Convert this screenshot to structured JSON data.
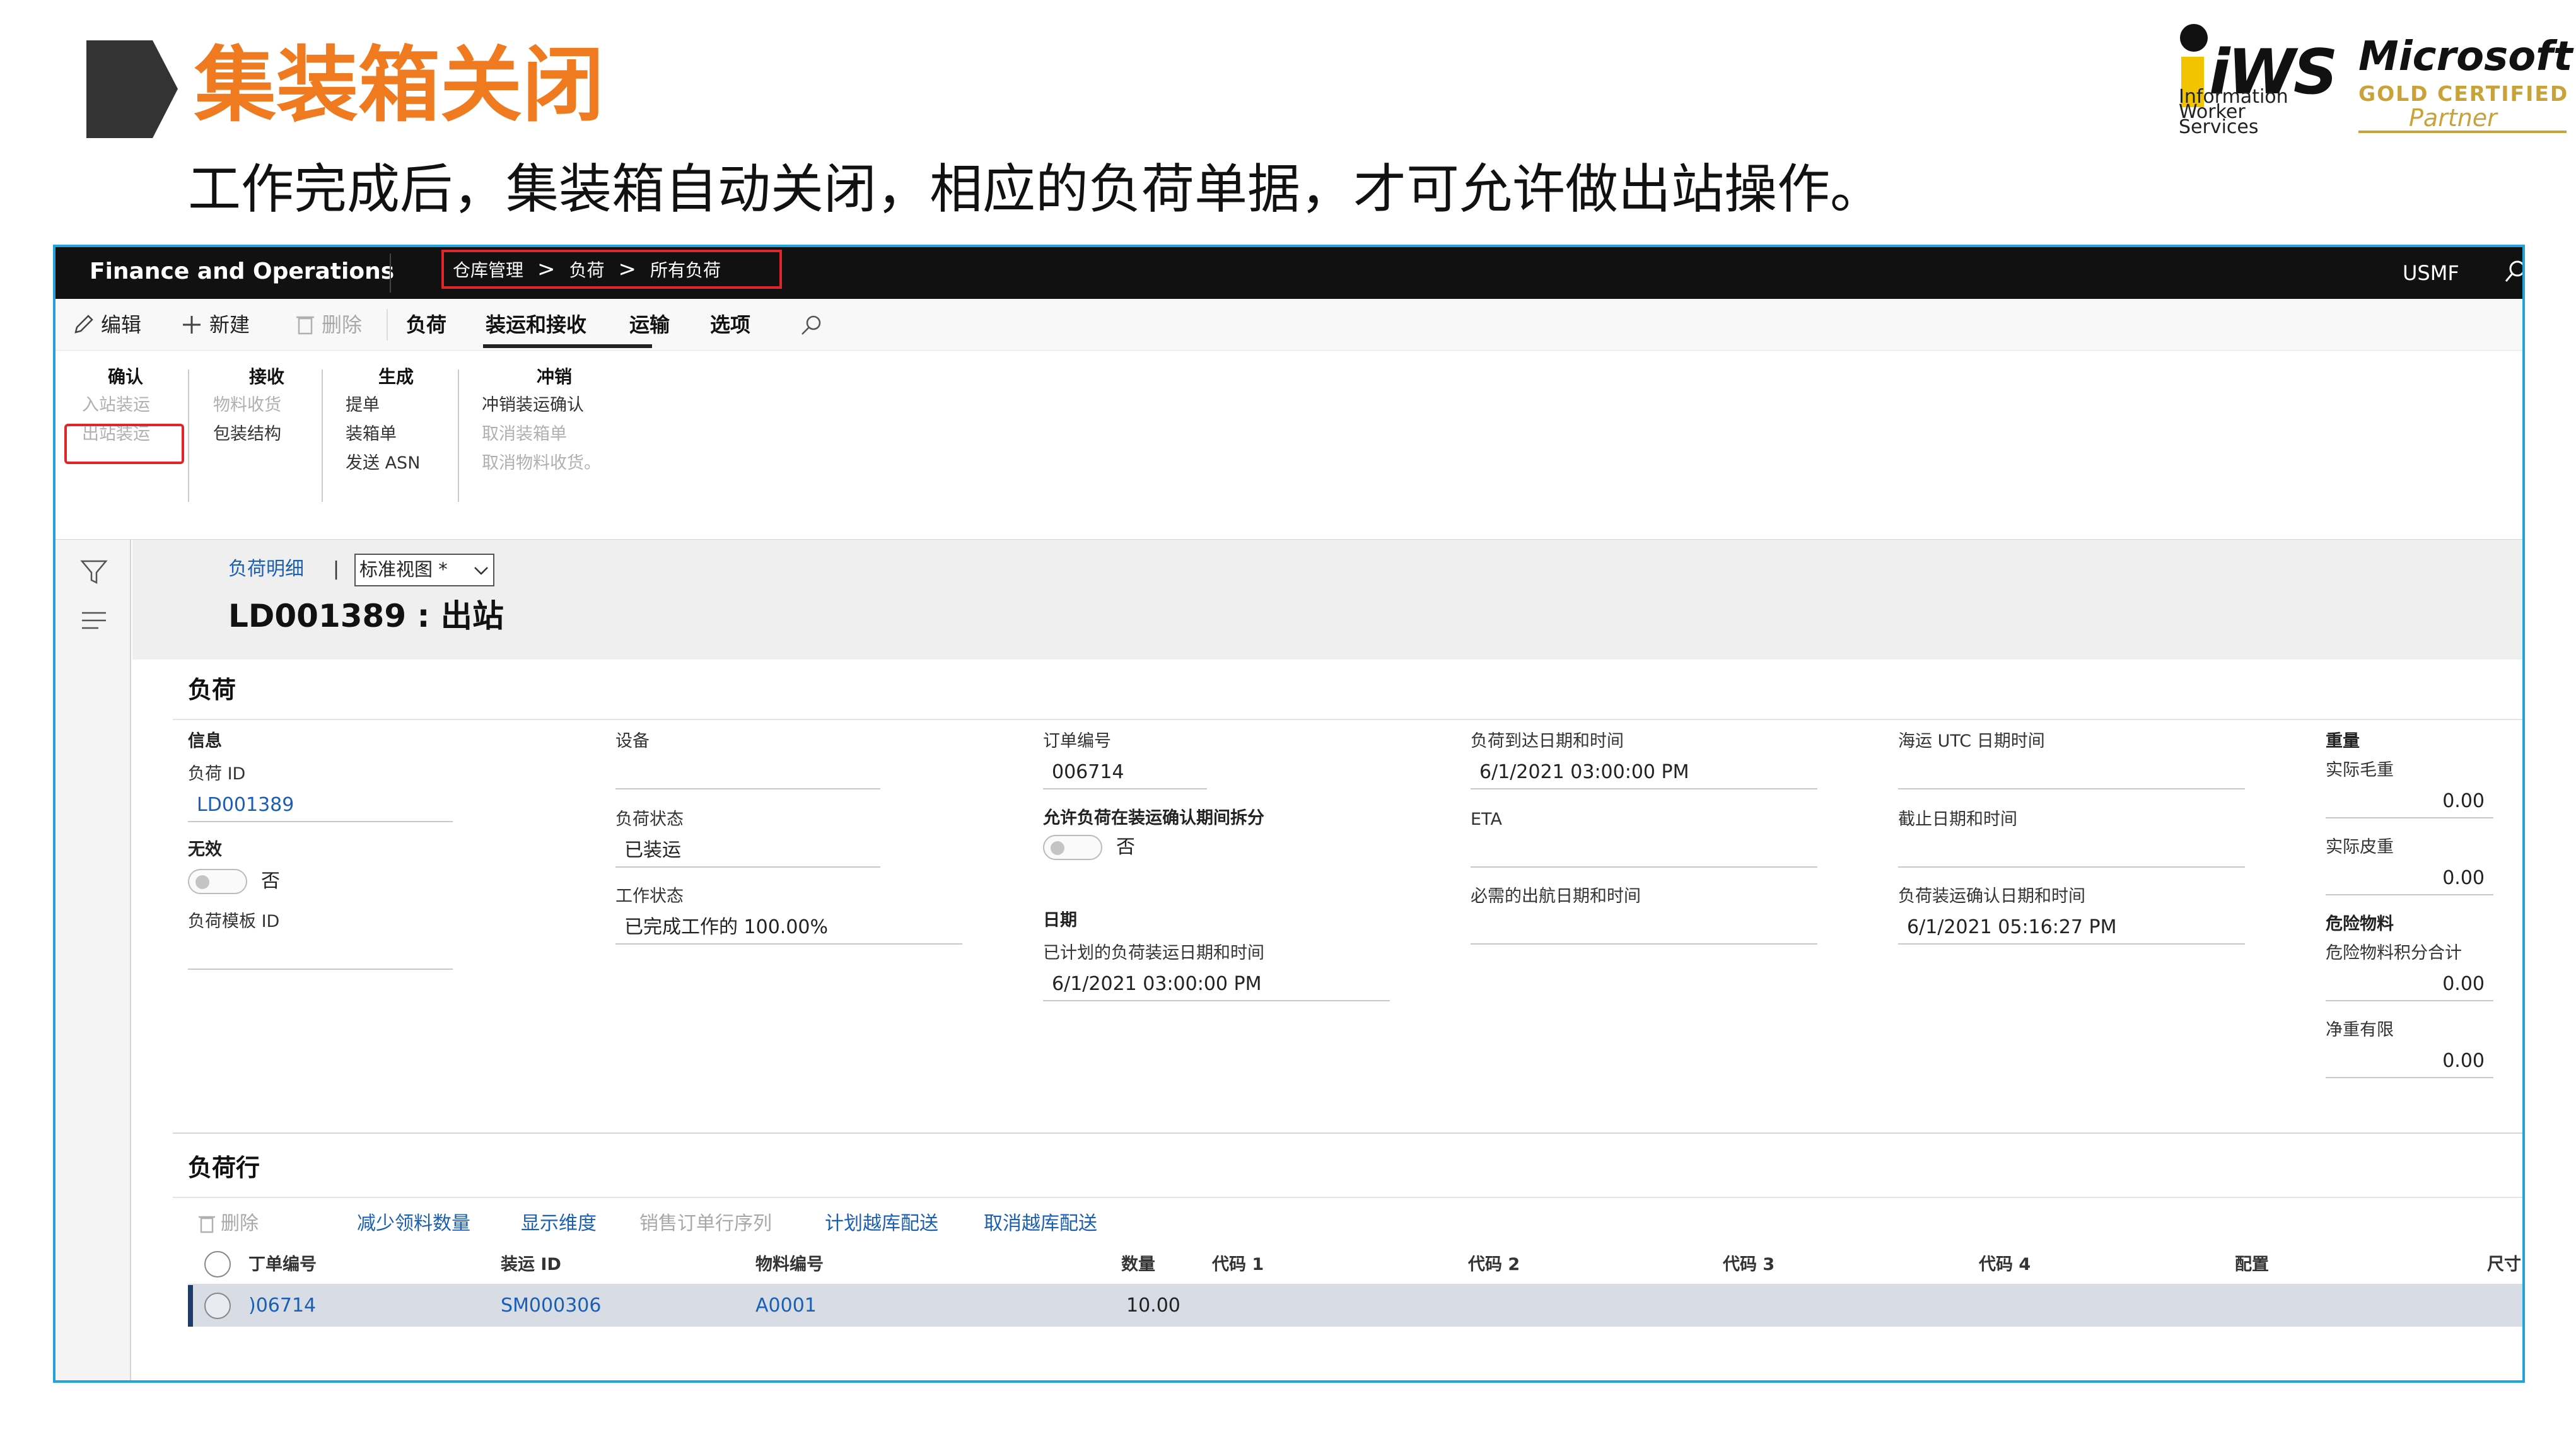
{
  "slide": {
    "title": "集装箱关闭",
    "subtitle": "工作完成后，集装箱自动关闭，相应的负荷单据，才可允许做出站操作。",
    "iws": {
      "mark": "iWS",
      "sub": "Information\nWorker\nServices"
    },
    "microsoft": {
      "name": "Microsoft",
      "gold": "GOLD CERTIFIED",
      "partner": "Partner"
    }
  },
  "colors": {
    "accent_orange": "#f07a20",
    "frame_blue": "#24a2dc",
    "highlight_red": "#e0262b",
    "link_blue": "#1a5fb4"
  },
  "navbar": {
    "app_name": "Finance and Operations",
    "breadcrumb": [
      "仓库管理",
      "负荷",
      "所有负荷"
    ],
    "company": "USMF"
  },
  "actionbar": {
    "edit": "编辑",
    "new": "新建",
    "delete": "删除",
    "tab_load": "负荷",
    "tab_ship_receive": "装运和接收",
    "tab_transport": "运输",
    "tab_options": "选项"
  },
  "ribbon": {
    "confirm": {
      "title": "确认",
      "items": [
        "入站装运",
        "出站装运"
      ]
    },
    "receive": {
      "title": "接收",
      "items": [
        "物料收货",
        "包装结构"
      ]
    },
    "generate": {
      "title": "生成",
      "items": [
        "提单",
        "装箱单",
        "发送 ASN"
      ]
    },
    "reverse": {
      "title": "冲销",
      "items": [
        "冲销装运确认",
        "取消装箱单",
        "取消物料收货。"
      ]
    }
  },
  "page": {
    "crumb_link": "负荷明细",
    "view": "标准视图 *",
    "record_title": "LD001389 : 出站"
  },
  "load": {
    "title": "负荷",
    "info_group": "信息",
    "load_id_label": "负荷 ID",
    "load_id": "LD001389",
    "invalid_label": "无效",
    "invalid_value": "否",
    "template_label": "负荷模板 ID",
    "equipment_label": "设备",
    "status_label": "负荷状态",
    "status_value": "已装运",
    "work_status_label": "工作状态",
    "work_status_value": "已完成工作的 100.00%",
    "order_no_label": "订单编号",
    "order_no": "006714",
    "allow_split_label": "允许负荷在装运确认期间拆分",
    "allow_split_value": "否",
    "date_group": "日期",
    "planned_ship_label": "已计划的负荷装运日期和时间",
    "planned_ship_value": "6/1/2021 03:00:00 PM",
    "arrival_label": "负荷到达日期和时间",
    "arrival_value": "6/1/2021 03:00:00 PM",
    "eta_label": "ETA",
    "req_sail_label": "必需的出航日期和时间",
    "sea_utc_label": "海运 UTC 日期时间",
    "cutoff_label": "截止日期和时间",
    "ship_confirm_label": "负荷装运确认日期和时间",
    "ship_confirm_value": "6/1/2021 05:16:27 PM",
    "weight_group": "重量",
    "gross_label": "实际毛重",
    "gross_value": "0.00",
    "tare_label": "实际皮重",
    "tare_value": "0.00",
    "hazmat_group": "危险物料",
    "hazmat_points_label": "危险物料积分合计",
    "hazmat_points_value": "0.00",
    "net_limit_label": "净重有限",
    "net_limit_value": "0.00"
  },
  "lines": {
    "title": "负荷行",
    "actions": {
      "delete": "删除",
      "reduce": "减少领料数量",
      "dimensions": "显示维度",
      "sales_seq": "销售订单行序列",
      "plan_cross": "计划越库配送",
      "cancel_cross": "取消越库配送"
    },
    "headers": {
      "order": "丁单编号",
      "shipment": "装运 ID",
      "item": "物料编号",
      "qty": "数量",
      "code1": "代码 1",
      "code2": "代码 2",
      "code3": "代码 3",
      "code4": "代码 4",
      "config": "配置",
      "size": "尺寸"
    },
    "rows": [
      {
        "order": ")06714",
        "shipment": "SM000306",
        "item": "A0001",
        "qty": "10.00"
      }
    ]
  }
}
